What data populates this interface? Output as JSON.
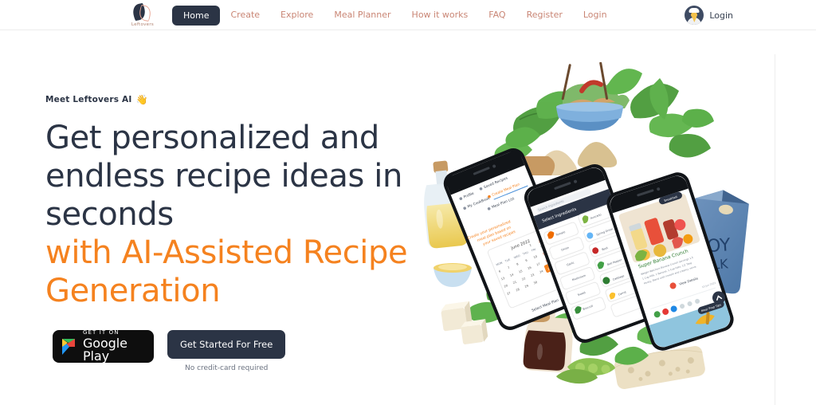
{
  "brand": {
    "logo_icon": "leftovers-leaf-logo",
    "logo_text": "Leftovers"
  },
  "header": {
    "nav_items": [
      {
        "label": "Home",
        "active": true
      },
      {
        "label": "Create",
        "active": false
      },
      {
        "label": "Explore",
        "active": false
      },
      {
        "label": "Meal Planner",
        "active": false
      },
      {
        "label": "How it works",
        "active": false
      },
      {
        "label": "FAQ",
        "active": false
      },
      {
        "label": "Register",
        "active": false
      },
      {
        "label": "Login",
        "active": false
      }
    ],
    "account": {
      "avatar_icon": "chef-avatar-icon",
      "login_label": "Login"
    }
  },
  "hero": {
    "eyebrow": "Meet Leftovers AI",
    "eyebrow_emoji": "👋",
    "headline_line1": "Get personalized and",
    "headline_line2": "endless recipe ideas in",
    "headline_line3": "seconds",
    "headline_accent_line1": "with AI-Assisted Recipe",
    "headline_accent_line2": "Generation",
    "cta": {
      "google_play_small": "GET IT ON",
      "google_play_big": "Google Play",
      "primary_label": "Get Started For Free",
      "note": "No credit-card required"
    }
  },
  "illustration": {
    "name": "soy-ingredients-phone-mockups",
    "phones": [
      {
        "id": "phone-meal-plan",
        "menu": [
          "Profile",
          "Saved Recipes",
          "My CookBook",
          "Create Meal Plan",
          "Meal Plan List"
        ],
        "tagline": "Create your personalized meal plan based on your saved recipes",
        "calendar_month": "June 2022",
        "calendar_days": [
          "MON",
          "TUE",
          "WED",
          "THU",
          "FRI",
          "SAT",
          "SUN"
        ],
        "footer_button": "Select Meal Plan"
      },
      {
        "id": "phone-ingredients",
        "title": "Select Ingredients",
        "items": [
          "Avocado",
          "Spring Onion",
          "Beet",
          "Bell Pepper",
          "Cabbage",
          "Carrot",
          "Broccoli"
        ]
      },
      {
        "id": "phone-recipe",
        "badge": "Breakfast",
        "title": "Banana Crunch",
        "cta": "View Details",
        "footer_badge": "Meal Prep Tips"
      }
    ],
    "food_items": [
      "soy milk carton",
      "soy sauce bottle",
      "tofu cubes",
      "edamame pods",
      "soy leaves",
      "salad bowl",
      "oil bottle",
      "tempeh block",
      "soy flour"
    ]
  },
  "colors": {
    "brand_navy": "#2b3445",
    "accent_orange": "#f5821f",
    "nav_link": "#c98574",
    "divider": "#eeeeee"
  }
}
